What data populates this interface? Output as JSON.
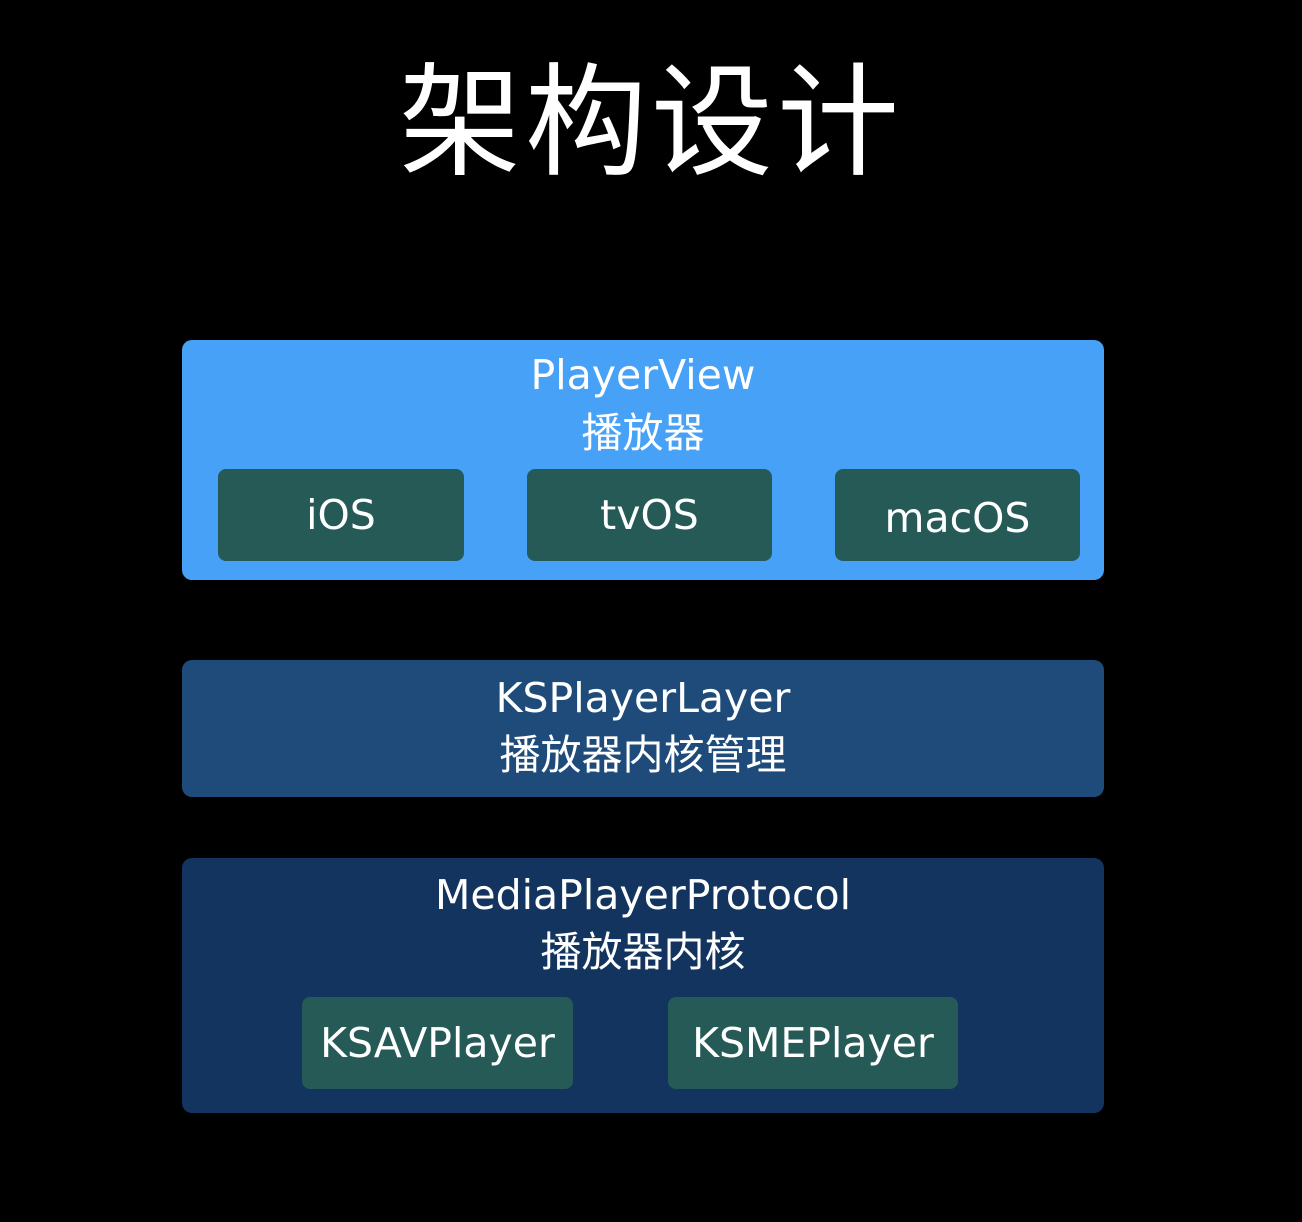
{
  "title": "架构设计",
  "colors": {
    "background": "#000000",
    "player_view_layer": "#46a1f7",
    "player_layer_layer": "#1e4b7a",
    "protocol_layer": "#12345e",
    "chip": "#265a57",
    "text": "#ffffff"
  },
  "layers": {
    "player_view": {
      "name": "PlayerView",
      "desc": "播放器",
      "platforms": [
        "iOS",
        "tvOS",
        "macOS"
      ]
    },
    "player_layer": {
      "name": "KSPlayerLayer",
      "desc": "播放器内核管理"
    },
    "protocol": {
      "name": "MediaPlayerProtocol",
      "desc": "播放器内核",
      "implementations": [
        "KSAVPlayer",
        "KSMEPlayer"
      ]
    }
  }
}
